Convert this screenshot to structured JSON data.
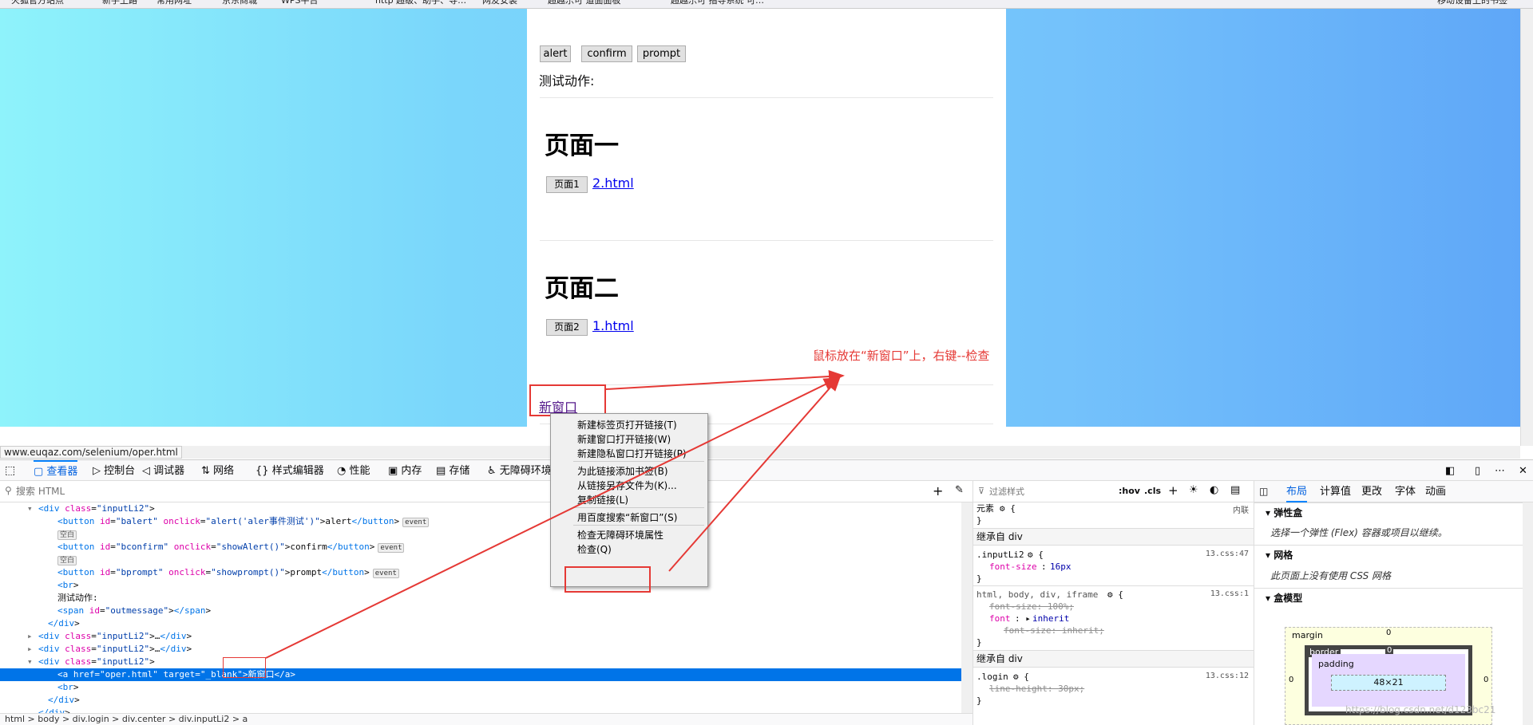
{
  "bookmarks": [
    "火狐官方站点",
    "新手上路",
    "常用网址",
    "京东商城",
    "WPS平台",
    "http 超级、助手、导…",
    "网友安装",
    "超越乐可 道面面板",
    "超越乐可 指导系统 可…",
    "移动设备上的书签"
  ],
  "page": {
    "buttons": {
      "alert": "alert",
      "confirm": "confirm",
      "prompt": "prompt"
    },
    "test_action_label": "测试动作:",
    "section1": {
      "heading": "页面一",
      "button": "页面1",
      "link": "2.html"
    },
    "section2": {
      "heading": "页面二",
      "button": "页面2",
      "link": "1.html"
    },
    "new_window_link": "新窗口"
  },
  "annotation": {
    "text": "鼠标放在“新窗口”上，右键--检查",
    "color": "#e53935"
  },
  "status_url": "www.euqaz.com/selenium/oper.html",
  "context_menu": {
    "items": [
      "新建标签页打开链接(T)",
      "新建窗口打开链接(W)",
      "新建隐私窗口打开链接(P)",
      "为此链接添加书签(B)",
      "从链接另存文件为(K)...",
      "复制链接(L)",
      "用百度搜索“新窗口”(S)",
      "检查无障碍环境属性",
      "检查(Q)"
    ]
  },
  "devtools": {
    "tabs": [
      "查看器",
      "控制台",
      "调试器",
      "网络",
      "样式编辑器",
      "性能",
      "内存",
      "存储",
      "无障碍环境"
    ],
    "search_placeholder": "搜索 HTML",
    "markup": [
      {
        "t": "<div class=\"inputLi2\">"
      },
      {
        "t": "<button id=\"balert\" onclick=\"alert('aler事件测试')\">alert</button>",
        "badge": "event"
      },
      {
        "t": "空白",
        "ws": true
      },
      {
        "t": "<button id=\"bconfirm\" onclick=\"showAlert()\">confirm</button>",
        "badge": "event"
      },
      {
        "t": "空白",
        "ws": true
      },
      {
        "t": "<button id=\"bprompt\" onclick=\"showprompt()\">prompt</button>",
        "badge": "event"
      },
      {
        "t": "<br>"
      },
      {
        "t": "测试动作:"
      },
      {
        "t": "<span id=\"outmessage\"></span>"
      },
      {
        "t": "</div>"
      },
      {
        "t": "<div class=\"inputLi2\">…</div>"
      },
      {
        "t": "<div class=\"inputLi2\">…</div>"
      },
      {
        "t": "<div class=\"inputLi2\">"
      },
      {
        "t": "<a href=\"oper.html\" target=\"_blank\">新窗口</a>",
        "selected": true
      },
      {
        "t": "<br>"
      },
      {
        "t": "</div>"
      },
      {
        "t": "</div>"
      }
    ],
    "breadcrumbs": "html > body > div.login > div.center > div.inputLi2 > a",
    "rules": {
      "filter_placeholder": "过滤样式",
      "hov": ":hov",
      "cls": ".cls",
      "element_label": "元素",
      "inline_label": "内联",
      "inherit1": "继承自 div",
      "inherit2": "继承自 div",
      "r1_selector": ".inputLi2",
      "r1_src": "13.css:47",
      "r1_prop": "font-size",
      "r1_val": "16px",
      "r2_selector": "html, body, div, iframe",
      "r2_src": "13.css:1",
      "r2_p1": "font-size: 100%;",
      "r2_p2": "font",
      "r2_p2v": "inherit",
      "r2_p3": "font-size: inherit;",
      "r3_selector": ".login",
      "r3_src": "13.css:12",
      "r3_p1": "line-height: 30px;"
    },
    "layout_tabs": [
      "布局",
      "计算值",
      "更改",
      "字体",
      "动画"
    ],
    "layout": {
      "flex_title": "弹性盒",
      "flex_note": "选择一个弹性 (Flex) 容器或项目以继续。",
      "grid_title": "网格",
      "grid_note": "此页面上没有使用 CSS 网格",
      "box_title": "盒模型",
      "margin": "margin",
      "border": "border",
      "padding": "padding",
      "content": "48×21",
      "zero": "0"
    }
  },
  "watermark": "https://blog.csdn.net/d123bc21"
}
